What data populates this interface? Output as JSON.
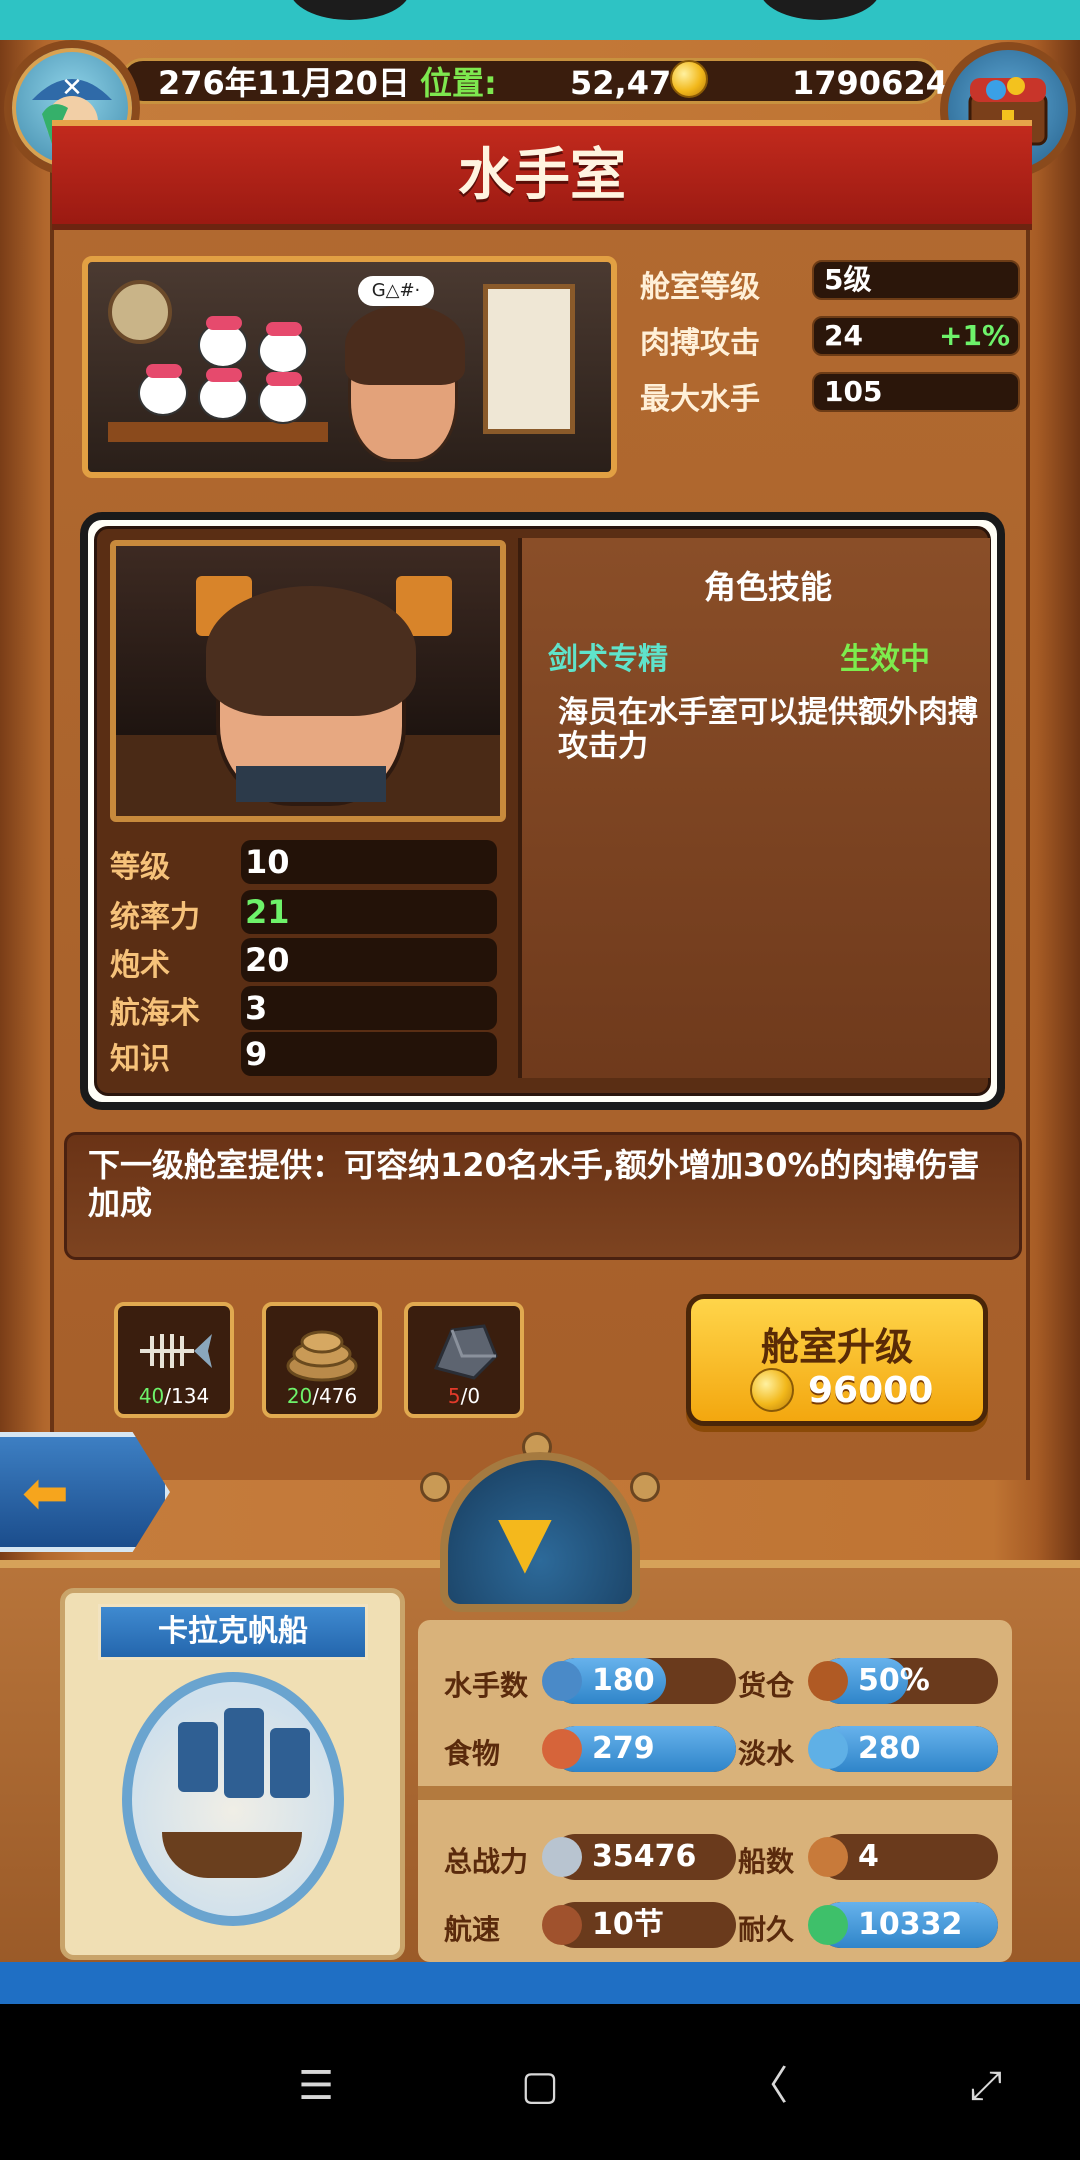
{
  "header": {
    "date": "276年11月20日",
    "position_label": "位置:",
    "position_value": "52,47",
    "gold": "1790624"
  },
  "title": "水手室",
  "room_stats": [
    {
      "label": "舱室等级",
      "value": "5级",
      "bonus": ""
    },
    {
      "label": "肉搏攻击",
      "value": "24",
      "bonus": "+1%"
    },
    {
      "label": "最大水手",
      "value": "105",
      "bonus": ""
    }
  ],
  "room_picture": {
    "speech": "G△#·"
  },
  "character": {
    "attributes": [
      {
        "label": "等级",
        "value": "10",
        "highlight": false
      },
      {
        "label": "统率力",
        "value": "21",
        "highlight": true
      },
      {
        "label": "炮术",
        "value": "20",
        "highlight": false
      },
      {
        "label": "航海术",
        "value": "3",
        "highlight": false
      },
      {
        "label": "知识",
        "value": "9",
        "highlight": false
      }
    ],
    "skill_title": "角色技能",
    "skill_name": "剑术专精",
    "skill_status": "生效中",
    "skill_desc": "海员在水手室可以提供额外肉搏攻击力"
  },
  "next_level": "下一级舱室提供：可容纳120名水手,额外增加30%的肉搏伤害加成",
  "materials": [
    {
      "icon": "fishbone-icon",
      "have": "40",
      "need": "/134",
      "enough": true
    },
    {
      "icon": "rope-icon",
      "have": "20",
      "need": "/476",
      "enough": true
    },
    {
      "icon": "iron-ore-icon",
      "have": "5",
      "need": "/0",
      "enough": false
    }
  ],
  "upgrade": {
    "label": "舱室升级",
    "cost": "96000"
  },
  "ship": {
    "name": "卡拉克帆船",
    "stats": [
      {
        "label": "水手数",
        "value": "180",
        "icon": "sailor-icon",
        "fill": 0.62
      },
      {
        "label": "货仓",
        "value": "50%",
        "icon": "cargo-icon",
        "fill": 0.5
      },
      {
        "label": "食物",
        "value": "279",
        "icon": "meat-icon",
        "fill": 1.0
      },
      {
        "label": "淡水",
        "value": "280",
        "icon": "water-icon",
        "fill": 1.0
      },
      {
        "label": "总战力",
        "value": "35476",
        "icon": "swords-icon",
        "fill": 0.0
      },
      {
        "label": "船数",
        "value": "4",
        "icon": "ship-icon",
        "fill": 0.0
      },
      {
        "label": "航速",
        "value": "10节",
        "icon": "boat-icon",
        "fill": 0.0
      },
      {
        "label": "耐久",
        "value": "10332",
        "icon": "durability-icon",
        "fill": 1.0
      }
    ]
  },
  "colors": {
    "accent_green": "#6ef26a",
    "skill_cyan": "#5fe3cb",
    "bar_blue": "#2f85c9"
  }
}
